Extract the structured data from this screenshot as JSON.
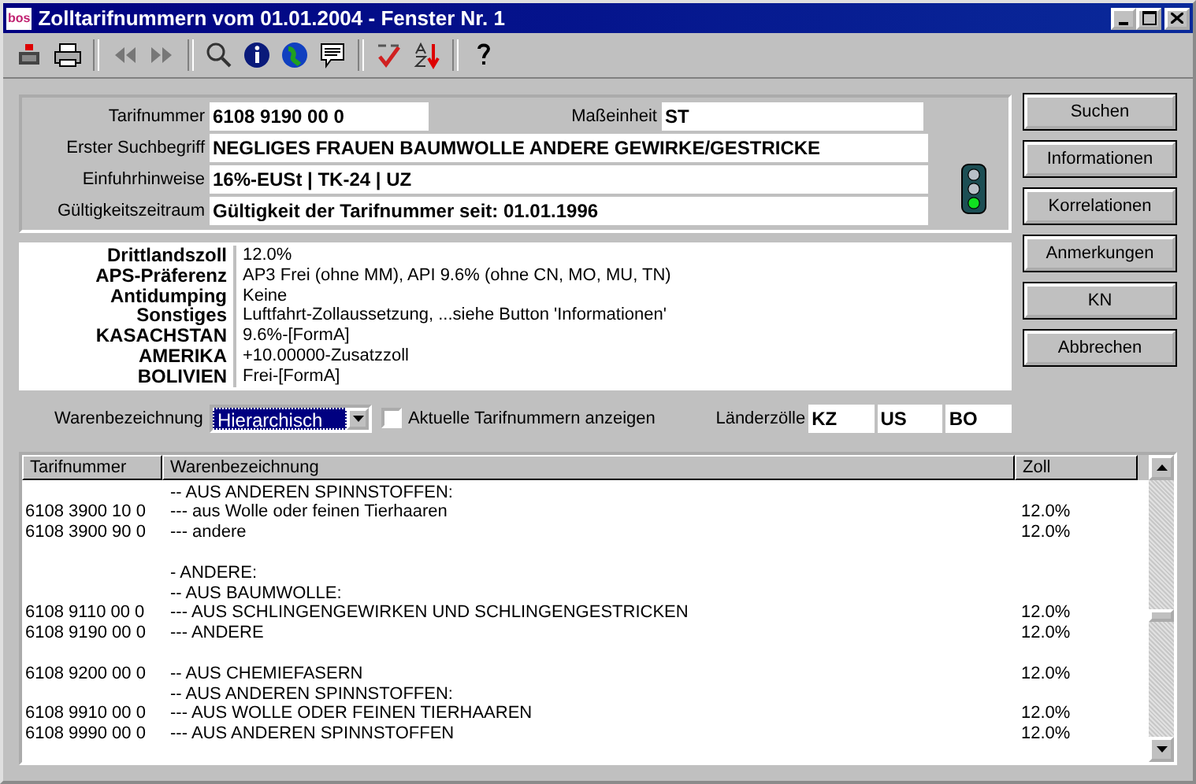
{
  "window": {
    "title": "Zolltarifnummern vom 01.01.2004 - Fenster Nr. 1",
    "app_badge": "bos"
  },
  "toolbar": [
    {
      "kind": "export"
    },
    {
      "kind": "print"
    },
    {
      "kind": "sep"
    },
    {
      "kind": "back"
    },
    {
      "kind": "forward"
    },
    {
      "kind": "sep"
    },
    {
      "kind": "search"
    },
    {
      "kind": "info"
    },
    {
      "kind": "globe"
    },
    {
      "kind": "note"
    },
    {
      "kind": "sep"
    },
    {
      "kind": "check"
    },
    {
      "kind": "sort"
    },
    {
      "kind": "sep"
    },
    {
      "kind": "help"
    }
  ],
  "header": {
    "fields": [
      {
        "label": "Tarifnummer",
        "value": "6108 9190 00 0"
      },
      {
        "label": "Maßeinheit",
        "value": "ST"
      },
      {
        "label": "Erster Suchbegriff",
        "value": "NEGLIGES FRAUEN BAUMWOLLE ANDERE GEWIRKE/GESTRICKE"
      },
      {
        "label": "Einfuhrhinweise",
        "value": "16%-EUSt | TK-24 | UZ"
      },
      {
        "label": "Gültigkeitszeitraum",
        "value": "Gültigkeit der Tarifnummer seit: 01.01.1996"
      }
    ],
    "status_lamps": [
      {
        "on": false
      },
      {
        "on": false
      },
      {
        "on": true
      }
    ]
  },
  "duties": [
    {
      "label": "Drittlandszoll",
      "value": "12.0%"
    },
    {
      "label": "APS-Präferenz",
      "value": "AP3 Frei (ohne MM), API 9.6% (ohne CN, MO, MU, TN)"
    },
    {
      "label": "Antidumping",
      "value": "Keine"
    },
    {
      "label": "Sonstiges",
      "value": "Luftfahrt-Zollaussetzung, ...siehe Button 'Informationen'"
    },
    {
      "label": "KASACHSTAN",
      "value": "9.6%-[FormA]"
    },
    {
      "label": "AMERIKA",
      "value": "+10.00000-Zusatzzoll"
    },
    {
      "label": "BOLIVIEN",
      "value": "Frei-[FormA]"
    }
  ],
  "options": {
    "description_label": "Warenbezeichnung",
    "description_mode": "Hierarchisch",
    "current_only": {
      "label": "Aktuelle Tarifnummern anzeigen",
      "checked": false
    },
    "country_label": "Länderzölle",
    "countries": [
      "KZ",
      "US",
      "BO"
    ]
  },
  "buttons": [
    "Suchen",
    "Informationen",
    "Korrelationen",
    "Anmerkungen",
    "KN",
    "Abbrechen"
  ],
  "table": {
    "columns": [
      "Tarifnummer",
      "Warenbezeichnung",
      "Zoll"
    ],
    "rows": [
      {
        "kind": "line",
        "description": "-- AUS ANDEREN SPINNSTOFFEN:"
      },
      {
        "kind": "line",
        "number": "6108 3900 10 0",
        "description": "--- aus Wolle oder feinen Tierhaaren",
        "duty": "12.0%"
      },
      {
        "kind": "line",
        "number": "6108 3900 90 0",
        "description": "--- andere",
        "duty": "12.0%"
      },
      {
        "kind": "blank"
      },
      {
        "kind": "line",
        "description": "- ANDERE:"
      },
      {
        "kind": "line",
        "description": "-- AUS BAUMWOLLE:"
      },
      {
        "kind": "line",
        "number": "6108 9110 00 0",
        "description": "--- AUS SCHLINGENGEWIRKEN UND SCHLINGENGESTRICKEN",
        "duty": "12.0%"
      },
      {
        "kind": "line",
        "number": "6108 9190 00 0",
        "description": "--- ANDERE",
        "duty": "12.0%"
      },
      {
        "kind": "blank"
      },
      {
        "kind": "line",
        "number": "6108 9200 00 0",
        "description": "-- AUS CHEMIEFASERN",
        "duty": "12.0%"
      },
      {
        "kind": "line",
        "description": "-- AUS ANDEREN SPINNSTOFFEN:"
      },
      {
        "kind": "line",
        "number": "6108 9910 00 0",
        "description": "--- AUS WOLLE ODER FEINEN TIERHAAREN",
        "duty": "12.0%"
      },
      {
        "kind": "line",
        "number": "6108 9990 00 0",
        "description": "--- AUS ANDEREN SPINNSTOFFEN",
        "duty": "12.0%"
      }
    ]
  }
}
